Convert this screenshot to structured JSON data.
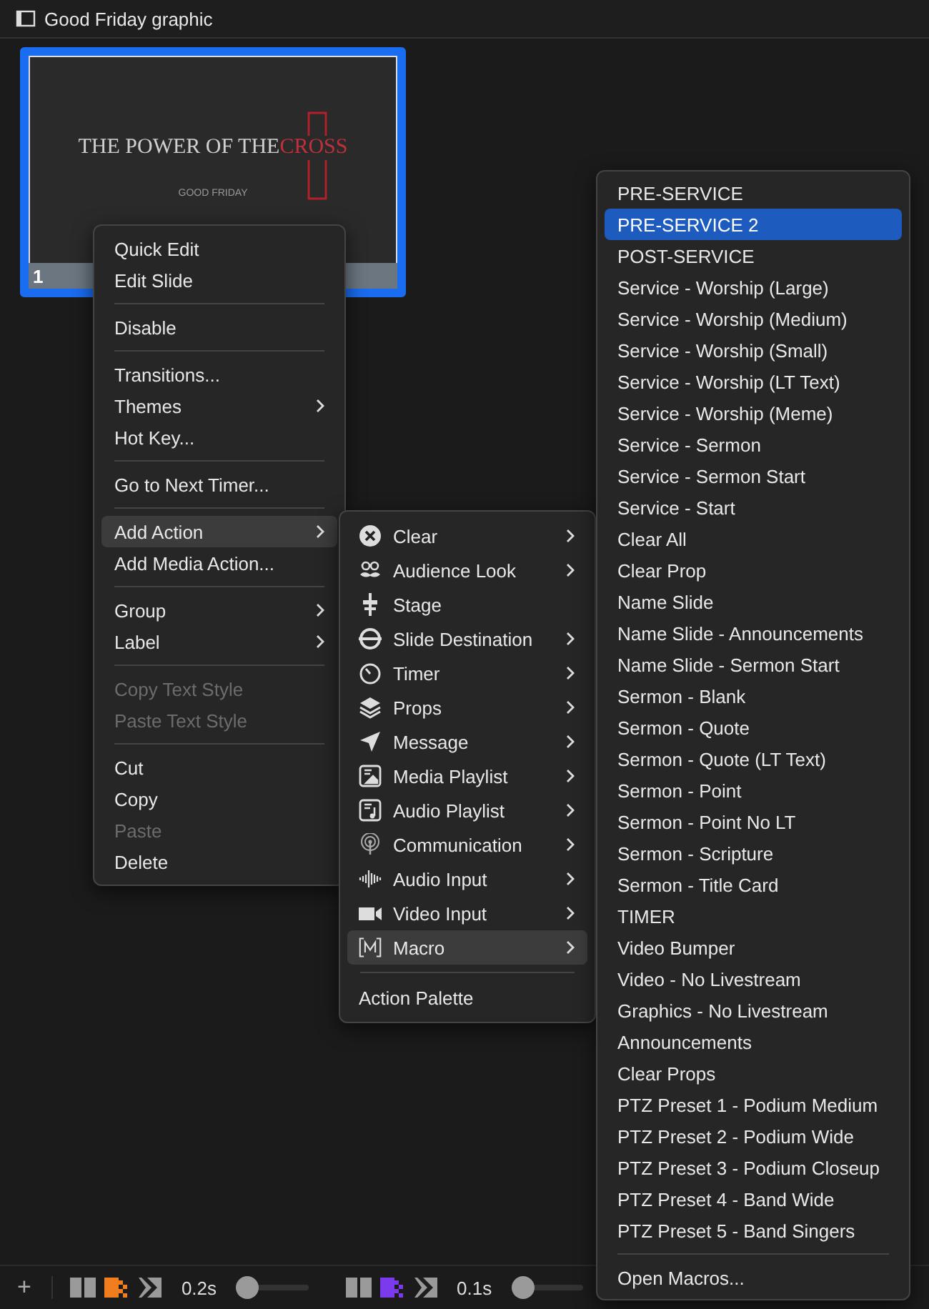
{
  "header": {
    "title": "Good Friday graphic"
  },
  "slide": {
    "number": "1",
    "selected": true,
    "title_text": "THE POWER OF THE",
    "accent_text": "CROSS",
    "subtitle": "GOOD FRIDAY"
  },
  "context_menu": {
    "items": [
      {
        "kind": "item",
        "label": "Quick Edit",
        "submenu": false,
        "disabled": false,
        "selected": false
      },
      {
        "kind": "item",
        "label": "Edit Slide",
        "submenu": false,
        "disabled": false,
        "selected": false
      },
      {
        "kind": "separator"
      },
      {
        "kind": "item",
        "label": "Disable",
        "submenu": false,
        "disabled": false,
        "selected": false
      },
      {
        "kind": "separator"
      },
      {
        "kind": "item",
        "label": "Transitions...",
        "submenu": false,
        "disabled": false,
        "selected": false
      },
      {
        "kind": "item",
        "label": "Themes",
        "submenu": true,
        "disabled": false,
        "selected": false
      },
      {
        "kind": "item",
        "label": "Hot Key...",
        "submenu": false,
        "disabled": false,
        "selected": false
      },
      {
        "kind": "separator"
      },
      {
        "kind": "item",
        "label": "Go to Next Timer...",
        "submenu": false,
        "disabled": false,
        "selected": false
      },
      {
        "kind": "separator"
      },
      {
        "kind": "item",
        "label": "Add Action",
        "submenu": true,
        "disabled": false,
        "selected": true
      },
      {
        "kind": "item",
        "label": "Add Media Action...",
        "submenu": false,
        "disabled": false,
        "selected": false
      },
      {
        "kind": "separator"
      },
      {
        "kind": "item",
        "label": "Group",
        "submenu": true,
        "disabled": false,
        "selected": false
      },
      {
        "kind": "item",
        "label": "Label",
        "submenu": true,
        "disabled": false,
        "selected": false
      },
      {
        "kind": "separator"
      },
      {
        "kind": "item",
        "label": "Copy Text Style",
        "submenu": false,
        "disabled": true,
        "selected": false
      },
      {
        "kind": "item",
        "label": "Paste Text Style",
        "submenu": false,
        "disabled": true,
        "selected": false
      },
      {
        "kind": "separator"
      },
      {
        "kind": "item",
        "label": "Cut",
        "submenu": false,
        "disabled": false,
        "selected": false
      },
      {
        "kind": "item",
        "label": "Copy",
        "submenu": false,
        "disabled": false,
        "selected": false
      },
      {
        "kind": "item",
        "label": "Paste",
        "submenu": false,
        "disabled": true,
        "selected": false
      },
      {
        "kind": "item",
        "label": "Delete",
        "submenu": false,
        "disabled": false,
        "selected": false
      }
    ]
  },
  "action_menu": {
    "items": [
      {
        "kind": "item",
        "label": "Clear",
        "submenu": true,
        "selected": false
      },
      {
        "kind": "item",
        "label": "Audience Look",
        "submenu": true,
        "selected": false
      },
      {
        "kind": "item",
        "label": "Stage",
        "submenu": false,
        "selected": false
      },
      {
        "kind": "item",
        "label": "Slide Destination",
        "submenu": true,
        "selected": false
      },
      {
        "kind": "item",
        "label": "Timer",
        "submenu": true,
        "selected": false
      },
      {
        "kind": "item",
        "label": "Props",
        "submenu": true,
        "selected": false
      },
      {
        "kind": "item",
        "label": "Message",
        "submenu": true,
        "selected": false
      },
      {
        "kind": "item",
        "label": "Media Playlist",
        "submenu": true,
        "selected": false
      },
      {
        "kind": "item",
        "label": "Audio Playlist",
        "submenu": true,
        "selected": false
      },
      {
        "kind": "item",
        "label": "Communication",
        "submenu": true,
        "selected": false
      },
      {
        "kind": "item",
        "label": "Audio Input",
        "submenu": true,
        "selected": false
      },
      {
        "kind": "item",
        "label": "Video Input",
        "submenu": true,
        "selected": false
      },
      {
        "kind": "item",
        "label": "Macro",
        "submenu": true,
        "selected": true
      },
      {
        "kind": "separator"
      },
      {
        "kind": "item",
        "label": "Action Palette",
        "submenu": false,
        "selected": false
      }
    ]
  },
  "macro_menu": {
    "items": [
      {
        "kind": "item",
        "label": "PRE-SERVICE",
        "selected": false
      },
      {
        "kind": "item",
        "label": "PRE-SERVICE 2",
        "selected": true
      },
      {
        "kind": "item",
        "label": "POST-SERVICE",
        "selected": false
      },
      {
        "kind": "item",
        "label": "Service - Worship (Large)",
        "selected": false
      },
      {
        "kind": "item",
        "label": "Service - Worship (Medium)",
        "selected": false
      },
      {
        "kind": "item",
        "label": "Service - Worship (Small)",
        "selected": false
      },
      {
        "kind": "item",
        "label": "Service - Worship (LT Text)",
        "selected": false
      },
      {
        "kind": "item",
        "label": "Service - Worship (Meme)",
        "selected": false
      },
      {
        "kind": "item",
        "label": "Service - Sermon",
        "selected": false
      },
      {
        "kind": "item",
        "label": "Service - Sermon Start",
        "selected": false
      },
      {
        "kind": "item",
        "label": "Service - Start",
        "selected": false
      },
      {
        "kind": "item",
        "label": "Clear All",
        "selected": false
      },
      {
        "kind": "item",
        "label": "Clear Prop",
        "selected": false
      },
      {
        "kind": "item",
        "label": "Name Slide",
        "selected": false
      },
      {
        "kind": "item",
        "label": "Name Slide - Announcements",
        "selected": false
      },
      {
        "kind": "item",
        "label": "Name Slide - Sermon Start",
        "selected": false
      },
      {
        "kind": "item",
        "label": "Sermon - Blank",
        "selected": false
      },
      {
        "kind": "item",
        "label": "Sermon - Quote",
        "selected": false
      },
      {
        "kind": "item",
        "label": "Sermon - Quote (LT Text)",
        "selected": false
      },
      {
        "kind": "item",
        "label": "Sermon - Point",
        "selected": false
      },
      {
        "kind": "item",
        "label": "Sermon - Point No LT",
        "selected": false
      },
      {
        "kind": "item",
        "label": "Sermon - Scripture",
        "selected": false
      },
      {
        "kind": "item",
        "label": "Sermon - Title Card",
        "selected": false
      },
      {
        "kind": "item",
        "label": "TIMER",
        "selected": false
      },
      {
        "kind": "item",
        "label": "Video Bumper",
        "selected": false
      },
      {
        "kind": "item",
        "label": "Video - No Livestream",
        "selected": false
      },
      {
        "kind": "item",
        "label": "Graphics - No Livestream",
        "selected": false
      },
      {
        "kind": "item",
        "label": "Announcements",
        "selected": false
      },
      {
        "kind": "item",
        "label": "Clear Props",
        "selected": false
      },
      {
        "kind": "item",
        "label": "PTZ Preset 1 - Podium Medium",
        "selected": false
      },
      {
        "kind": "item",
        "label": "PTZ Preset 2 - Podium Wide",
        "selected": false
      },
      {
        "kind": "item",
        "label": "PTZ Preset 3 - Podium Closeup",
        "selected": false
      },
      {
        "kind": "item",
        "label": "PTZ Preset 4 - Band Wide",
        "selected": false
      },
      {
        "kind": "item",
        "label": "PTZ Preset 5 - Band Singers",
        "selected": false
      },
      {
        "kind": "separator"
      },
      {
        "kind": "item",
        "label": "Open Macros...",
        "selected": false
      }
    ]
  },
  "bottom_bar": {
    "add_button": "+",
    "transitions": [
      {
        "color": "#f07d1e",
        "duration": "0.2s",
        "level": 0.03
      },
      {
        "color": "#7c3aed",
        "duration": "0.1s",
        "level": 0.03
      }
    ]
  }
}
